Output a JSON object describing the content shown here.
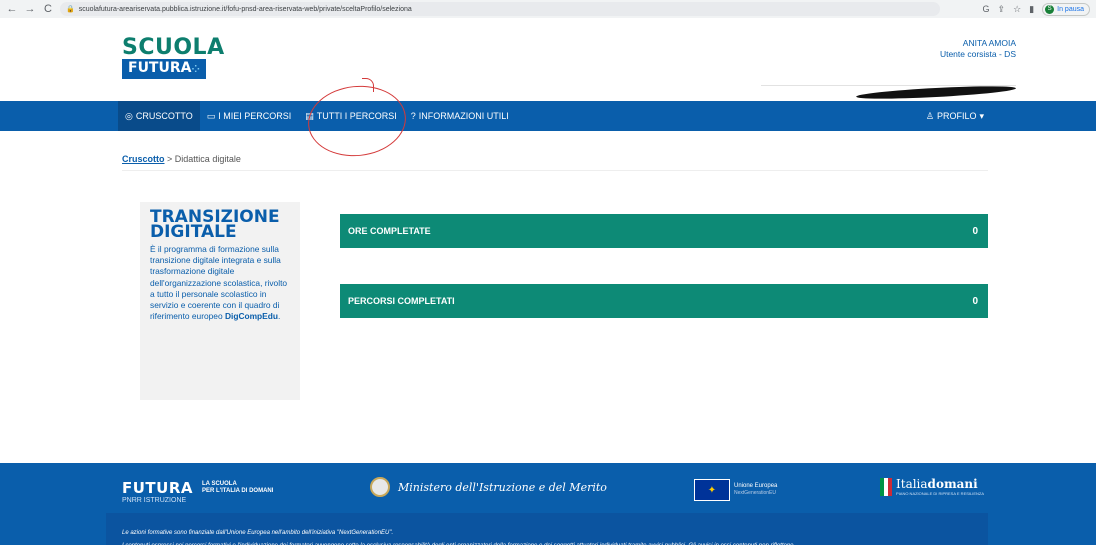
{
  "browser": {
    "url": "scuolafutura-areariservata.pubblica.istruzione.it/fofu-pnsd-area-riservata-web/private/sceltaProfilo/seleziona",
    "profile_status": "In pausa",
    "profile_initial": "S"
  },
  "header": {
    "logo_line1": "SCUOLA",
    "logo_line2": "FUTURA",
    "user_name": "ANITA AMOIA",
    "user_role": "Utente corsista - DS"
  },
  "nav": {
    "items": [
      {
        "label": "CRUSCOTTO",
        "icon": "◎"
      },
      {
        "label": "I MIEI PERCORSI",
        "icon": "▭"
      },
      {
        "label": "TUTTI I PERCORSI",
        "icon": "▤"
      },
      {
        "label": "INFORMAZIONI UTILI",
        "icon": "?"
      }
    ],
    "profile_label": "PROFILO"
  },
  "breadcrumb": {
    "root": "Cruscotto",
    "separator": ">",
    "current": "Didattica digitale"
  },
  "info": {
    "title_line1": "TRANSIZIONE",
    "title_line2": "DIGITALE",
    "text": "È il programma di formazione sulla transizione digitale integrata e sulla trasformazione digitale dell'organizzazione scolastica, rivolto a tutto il personale scolastico in servizio e coerente con il quadro di riferimento europeo",
    "highlight": "DigCompEdu",
    "end": "."
  },
  "stats": [
    {
      "label": "ORE COMPLETATE",
      "value": "0"
    },
    {
      "label": "PERCORSI COMPLETATI",
      "value": "0"
    }
  ],
  "footer": {
    "futura": "FUTURA",
    "pnrr": "PNRR ISTRUZIONE",
    "tagline_1": "LA SCUOLA",
    "tagline_2": "PER L'ITALIA DI DOMANI",
    "ministry": "Ministero dell'Istruzione e del Merito",
    "eu_1": "Unione Europea",
    "eu_2": "NextGenerationEU",
    "italia_1": "Italia",
    "italia_2": "domani",
    "italia_sub": "PIANO NAZIONALE DI RIPRESA E RESILIENZA",
    "line1": "Le azioni formative sono finanziate dall'Unione Europea nell'ambito dell'iniziativa \"NextGenerationEU\".",
    "line2": "I contenuti espressi nei percorsi formativi e l'individuazione dei formatori avvengono sotto la esclusiva responsabilità degli enti organizzatori della formazione e dei soggetti attuatori individuati tramite avvisi pubblici. Gli avvisi in essi contenuti non riflettono"
  },
  "colors": {
    "primary_blue": "#0a5eab",
    "teal": "#0d8a76",
    "annotation_red": "#d43a3a"
  }
}
